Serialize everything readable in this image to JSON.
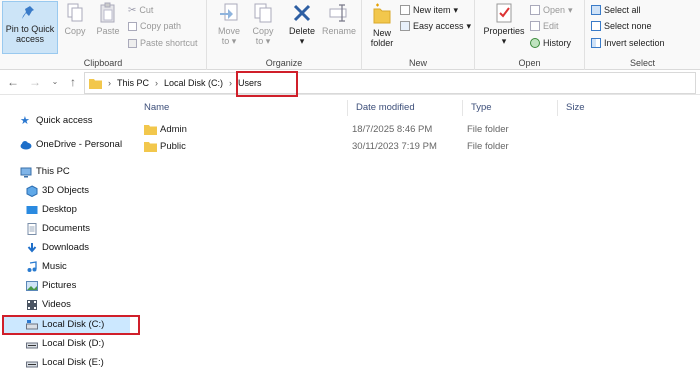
{
  "ribbon": {
    "clipboard": {
      "group_label": "Clipboard",
      "pin_label_1": "Pin to Quick",
      "pin_label_2": "access",
      "copy_label": "Copy",
      "paste_label": "Paste",
      "cut_label": "Cut",
      "copy_path_label": "Copy path",
      "paste_shortcut_label": "Paste shortcut"
    },
    "organize": {
      "group_label": "Organize",
      "move_to_label_1": "Move",
      "move_to_label_2": "to",
      "copy_to_label_1": "Copy",
      "copy_to_label_2": "to",
      "delete_label": "Delete",
      "rename_label": "Rename"
    },
    "new": {
      "group_label": "New",
      "new_folder_label_1": "New",
      "new_folder_label_2": "folder",
      "new_item_label": "New item",
      "easy_access_label": "Easy access"
    },
    "open": {
      "group_label": "Open",
      "properties_label": "Properties",
      "open_label": "Open",
      "edit_label": "Edit",
      "history_label": "History"
    },
    "select": {
      "group_label": "Select",
      "select_all_label": "Select all",
      "select_none_label": "Select none",
      "invert_selection_label": "Invert selection"
    }
  },
  "address": {
    "crumbs": [
      "This PC",
      "Local Disk (C:)",
      "Users"
    ]
  },
  "nav": {
    "items": [
      {
        "label": "Quick access",
        "icon": "star-icon"
      },
      {
        "label": "OneDrive - Personal",
        "icon": "cloud-icon"
      },
      {
        "label": "This PC",
        "icon": "computer-icon"
      },
      {
        "label": "3D Objects",
        "icon": "cube-icon"
      },
      {
        "label": "Desktop",
        "icon": "desktop-icon"
      },
      {
        "label": "Documents",
        "icon": "document-icon"
      },
      {
        "label": "Downloads",
        "icon": "download-icon"
      },
      {
        "label": "Music",
        "icon": "music-icon"
      },
      {
        "label": "Pictures",
        "icon": "pictures-icon"
      },
      {
        "label": "Videos",
        "icon": "video-icon"
      },
      {
        "label": "Local Disk (C:)",
        "icon": "drive-icon"
      },
      {
        "label": "Local Disk (D:)",
        "icon": "drive-icon"
      },
      {
        "label": "Local Disk (E:)",
        "icon": "drive-icon"
      }
    ]
  },
  "content": {
    "columns": [
      "Name",
      "Date modified",
      "Type",
      "Size"
    ],
    "rows": [
      {
        "name": "Admin",
        "date": "18/7/2025 8:46 PM",
        "type": "File folder",
        "size": ""
      },
      {
        "name": "Public",
        "date": "30/11/2023 7:19 PM",
        "type": "File folder",
        "size": ""
      }
    ]
  },
  "colors": {
    "highlight": "#d01f2a",
    "folder": "#f2c74c",
    "selection": "#cce8ff"
  }
}
